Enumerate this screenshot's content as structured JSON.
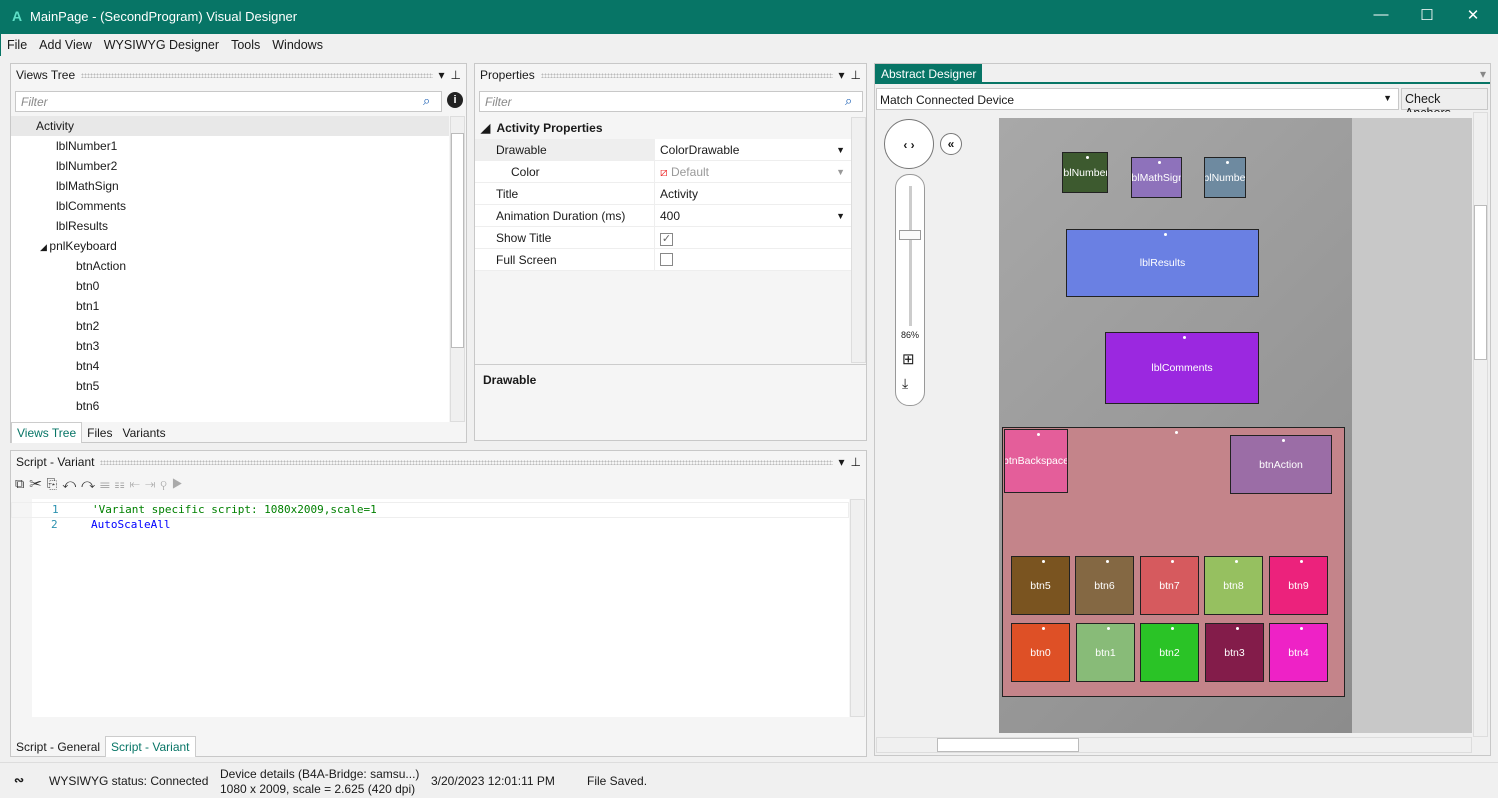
{
  "window": {
    "title": "MainPage - (SecondProgram) Visual Designer",
    "logo": "A",
    "minimize": "—",
    "maximize": "☐",
    "close": "✕"
  },
  "menu": [
    "File",
    "Add View",
    "WYSIWYG Designer",
    "Tools",
    "Windows"
  ],
  "views_tree": {
    "title": "Views Tree",
    "filter_placeholder": "Filter",
    "items": [
      {
        "label": "Activity",
        "level": 0,
        "selected": true
      },
      {
        "label": "lblNumber1",
        "level": 1
      },
      {
        "label": "lblNumber2",
        "level": 1
      },
      {
        "label": "lblMathSign",
        "level": 1
      },
      {
        "label": "lblComments",
        "level": 1
      },
      {
        "label": "lblResults",
        "level": 1
      },
      {
        "label": "pnlKeyboard",
        "level": 1,
        "expanded": true
      },
      {
        "label": "btnAction",
        "level": 2
      },
      {
        "label": "btn0",
        "level": 2
      },
      {
        "label": "btn1",
        "level": 2
      },
      {
        "label": "btn2",
        "level": 2
      },
      {
        "label": "btn3",
        "level": 2
      },
      {
        "label": "btn4",
        "level": 2
      },
      {
        "label": "btn5",
        "level": 2
      },
      {
        "label": "btn6",
        "level": 2
      }
    ],
    "tabs": [
      "Views Tree",
      "Files",
      "Variants"
    ],
    "active_tab": "Views Tree"
  },
  "properties": {
    "title": "Properties",
    "filter_placeholder": "Filter",
    "section": "Activity Properties",
    "rows": [
      {
        "key": "Drawable",
        "value": "ColorDrawable",
        "dropdown": true
      },
      {
        "key": "Color",
        "value": "Default",
        "dropdown": true
      },
      {
        "key": "Title",
        "value": "Activity"
      },
      {
        "key": "Animation Duration (ms)",
        "value": "400",
        "dropdown": true
      },
      {
        "key": "Show Title",
        "checked": true
      },
      {
        "key": "Full Screen",
        "checked": false
      }
    ],
    "description_title": "Drawable"
  },
  "script": {
    "title": "Script - Variant",
    "lines": [
      {
        "num": "1",
        "text": "'Variant specific script: 1080x2009,scale=1",
        "color": "#008000"
      },
      {
        "num": "2",
        "text": "AutoScaleAll",
        "color": "#0000ff"
      }
    ],
    "tabs": [
      "Script - General",
      "Script - Variant"
    ],
    "active_tab": "Script - Variant"
  },
  "designer": {
    "tab": "Abstract Designer",
    "variant_select": "Match Connected Device",
    "check_anchors": "Check Anchors",
    "zoom": "86%",
    "zoom_level_percent": 86,
    "views": [
      {
        "name": "lblNumber1",
        "label": "lblNumber",
        "color": "#3d5a2f"
      },
      {
        "name": "lblMathSign",
        "label": "lblMathSign",
        "color": "#8e72bb"
      },
      {
        "name": "lblNumber2",
        "label": "lblNumber",
        "color": "#6e8aa0"
      },
      {
        "name": "lblResults",
        "label": "lblResults",
        "color": "#6a80e3"
      },
      {
        "name": "lblComments",
        "label": "lblComments",
        "color": "#9b28e0"
      },
      {
        "name": "pnlKeyboard",
        "label": "pnlKeyboard",
        "color": "#c4848a"
      },
      {
        "name": "btnBackspace",
        "label": "btnBackspace",
        "color": "#e45e9a"
      },
      {
        "name": "btnAction",
        "label": "btnAction",
        "color": "#9b6da6"
      },
      {
        "name": "btn5",
        "label": "btn5",
        "color": "#7a5420"
      },
      {
        "name": "btn6",
        "label": "btn6",
        "color": "#846843"
      },
      {
        "name": "btn7",
        "label": "btn7",
        "color": "#d65a5e"
      },
      {
        "name": "btn8",
        "label": "btn8",
        "color": "#96c060"
      },
      {
        "name": "btn9",
        "label": "btn9",
        "color": "#ec227c"
      },
      {
        "name": "btn0",
        "label": "btn0",
        "color": "#de5026"
      },
      {
        "name": "btn1",
        "label": "btn1",
        "color": "#88bb78"
      },
      {
        "name": "btn2",
        "label": "btn2",
        "color": "#2ac326"
      },
      {
        "name": "btn3",
        "label": "btn3",
        "color": "#831c4a"
      },
      {
        "name": "btn4",
        "label": "btn4",
        "color": "#ee22c6"
      }
    ]
  },
  "status": {
    "wysiwyg": "WYSIWYG status: Connected",
    "device_line1": "Device details (B4A-Bridge: samsu...)",
    "device_line2": "1080 x 2009, scale = 2.625 (420 dpi)",
    "timestamp": "3/20/2023 12:01:11 PM",
    "message": "File Saved."
  },
  "colors": {
    "accent": "#077566"
  }
}
